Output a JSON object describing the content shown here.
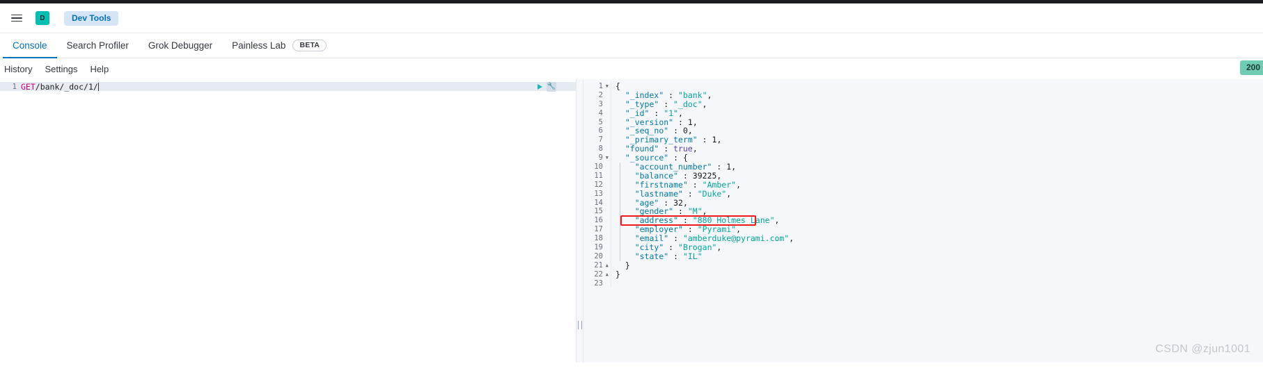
{
  "header": {
    "menu_icon": "hamburger-icon",
    "avatar_letter": "D",
    "app_name": "Dev Tools"
  },
  "tabs": [
    {
      "label": "Console",
      "active": true
    },
    {
      "label": "Search Profiler",
      "active": false
    },
    {
      "label": "Grok Debugger",
      "active": false
    },
    {
      "label": "Painless Lab",
      "active": false
    }
  ],
  "beta_badge": "BETA",
  "submenu": {
    "items": [
      "History",
      "Settings",
      "Help"
    ],
    "status_code": "200"
  },
  "request_editor": {
    "line_number": "1",
    "method": "GET",
    "path": "/bank/_doc/1/",
    "play_icon": "play-icon",
    "wrench_icon": "wrench-icon"
  },
  "response_editor": {
    "line_numbers": [
      "1",
      "2",
      "3",
      "4",
      "5",
      "6",
      "7",
      "8",
      "9",
      "10",
      "11",
      "12",
      "13",
      "14",
      "15",
      "16",
      "17",
      "18",
      "19",
      "20",
      "21",
      "22",
      "23"
    ],
    "fold_lines": {
      "1": "open",
      "9": "open",
      "21": "close",
      "22": "close"
    },
    "lines": [
      {
        "n": 1,
        "indent": 0,
        "tokens": [
          {
            "t": "brace",
            "v": "{"
          }
        ]
      },
      {
        "n": 2,
        "indent": 1,
        "tokens": [
          {
            "t": "key",
            "v": "\"_index\""
          },
          {
            "t": "punct",
            "v": " : "
          },
          {
            "t": "str",
            "v": "\"bank\""
          },
          {
            "t": "punct",
            "v": ","
          }
        ]
      },
      {
        "n": 3,
        "indent": 1,
        "tokens": [
          {
            "t": "key",
            "v": "\"_type\""
          },
          {
            "t": "punct",
            "v": " : "
          },
          {
            "t": "str",
            "v": "\"_doc\""
          },
          {
            "t": "punct",
            "v": ","
          }
        ]
      },
      {
        "n": 4,
        "indent": 1,
        "tokens": [
          {
            "t": "key",
            "v": "\"_id\""
          },
          {
            "t": "punct",
            "v": " : "
          },
          {
            "t": "str",
            "v": "\"1\""
          },
          {
            "t": "punct",
            "v": ","
          }
        ]
      },
      {
        "n": 5,
        "indent": 1,
        "tokens": [
          {
            "t": "key",
            "v": "\"_version\""
          },
          {
            "t": "punct",
            "v": " : "
          },
          {
            "t": "num",
            "v": "1"
          },
          {
            "t": "punct",
            "v": ","
          }
        ]
      },
      {
        "n": 6,
        "indent": 1,
        "tokens": [
          {
            "t": "key",
            "v": "\"_seq_no\""
          },
          {
            "t": "punct",
            "v": " : "
          },
          {
            "t": "num",
            "v": "0"
          },
          {
            "t": "punct",
            "v": ","
          }
        ]
      },
      {
        "n": 7,
        "indent": 1,
        "tokens": [
          {
            "t": "key",
            "v": "\"_primary_term\""
          },
          {
            "t": "punct",
            "v": " : "
          },
          {
            "t": "num",
            "v": "1"
          },
          {
            "t": "punct",
            "v": ","
          }
        ]
      },
      {
        "n": 8,
        "indent": 1,
        "tokens": [
          {
            "t": "key",
            "v": "\"found\""
          },
          {
            "t": "punct",
            "v": " : "
          },
          {
            "t": "bool",
            "v": "true"
          },
          {
            "t": "punct",
            "v": ","
          }
        ]
      },
      {
        "n": 9,
        "indent": 1,
        "tokens": [
          {
            "t": "key",
            "v": "\"_source\""
          },
          {
            "t": "punct",
            "v": " : "
          },
          {
            "t": "brace",
            "v": "{"
          }
        ]
      },
      {
        "n": 10,
        "indent": 2,
        "tokens": [
          {
            "t": "key",
            "v": "\"account_number\""
          },
          {
            "t": "punct",
            "v": " : "
          },
          {
            "t": "num",
            "v": "1"
          },
          {
            "t": "punct",
            "v": ","
          }
        ]
      },
      {
        "n": 11,
        "indent": 2,
        "tokens": [
          {
            "t": "key",
            "v": "\"balance\""
          },
          {
            "t": "punct",
            "v": " : "
          },
          {
            "t": "num",
            "v": "39225"
          },
          {
            "t": "punct",
            "v": ","
          }
        ]
      },
      {
        "n": 12,
        "indent": 2,
        "tokens": [
          {
            "t": "key",
            "v": "\"firstname\""
          },
          {
            "t": "punct",
            "v": " : "
          },
          {
            "t": "str",
            "v": "\"Amber\""
          },
          {
            "t": "punct",
            "v": ","
          }
        ]
      },
      {
        "n": 13,
        "indent": 2,
        "tokens": [
          {
            "t": "key",
            "v": "\"lastname\""
          },
          {
            "t": "punct",
            "v": " : "
          },
          {
            "t": "str",
            "v": "\"Duke\""
          },
          {
            "t": "punct",
            "v": ","
          }
        ]
      },
      {
        "n": 14,
        "indent": 2,
        "tokens": [
          {
            "t": "key",
            "v": "\"age\""
          },
          {
            "t": "punct",
            "v": " : "
          },
          {
            "t": "num",
            "v": "32"
          },
          {
            "t": "punct",
            "v": ","
          }
        ]
      },
      {
        "n": 15,
        "indent": 2,
        "tokens": [
          {
            "t": "key",
            "v": "\"gender\""
          },
          {
            "t": "punct",
            "v": " : "
          },
          {
            "t": "str",
            "v": "\"M\""
          },
          {
            "t": "punct",
            "v": ","
          }
        ]
      },
      {
        "n": 16,
        "indent": 2,
        "tokens": [
          {
            "t": "key",
            "v": "\"address\""
          },
          {
            "t": "punct",
            "v": " : "
          },
          {
            "t": "str",
            "v": "\"880 Holmes Lane\""
          },
          {
            "t": "punct",
            "v": ","
          }
        ]
      },
      {
        "n": 17,
        "indent": 2,
        "tokens": [
          {
            "t": "key",
            "v": "\"employer\""
          },
          {
            "t": "punct",
            "v": " : "
          },
          {
            "t": "str",
            "v": "\"Pyrami\""
          },
          {
            "t": "punct",
            "v": ","
          }
        ]
      },
      {
        "n": 18,
        "indent": 2,
        "tokens": [
          {
            "t": "key",
            "v": "\"email\""
          },
          {
            "t": "punct",
            "v": " : "
          },
          {
            "t": "str",
            "v": "\"amberduke@pyrami.com\""
          },
          {
            "t": "punct",
            "v": ","
          }
        ]
      },
      {
        "n": 19,
        "indent": 2,
        "tokens": [
          {
            "t": "key",
            "v": "\"city\""
          },
          {
            "t": "punct",
            "v": " : "
          },
          {
            "t": "str",
            "v": "\"Brogan\""
          },
          {
            "t": "punct",
            "v": ","
          }
        ]
      },
      {
        "n": 20,
        "indent": 2,
        "tokens": [
          {
            "t": "key",
            "v": "\"state\""
          },
          {
            "t": "punct",
            "v": " : "
          },
          {
            "t": "str",
            "v": "\"IL\""
          }
        ]
      },
      {
        "n": 21,
        "indent": 1,
        "tokens": [
          {
            "t": "brace",
            "v": "}"
          }
        ]
      },
      {
        "n": 22,
        "indent": 0,
        "tokens": [
          {
            "t": "brace",
            "v": "}"
          }
        ]
      },
      {
        "n": 23,
        "indent": 0,
        "tokens": []
      }
    ]
  },
  "annotation": {
    "target_line": 16,
    "color": "#f01818"
  },
  "watermark": "CSDN @zjun1001"
}
